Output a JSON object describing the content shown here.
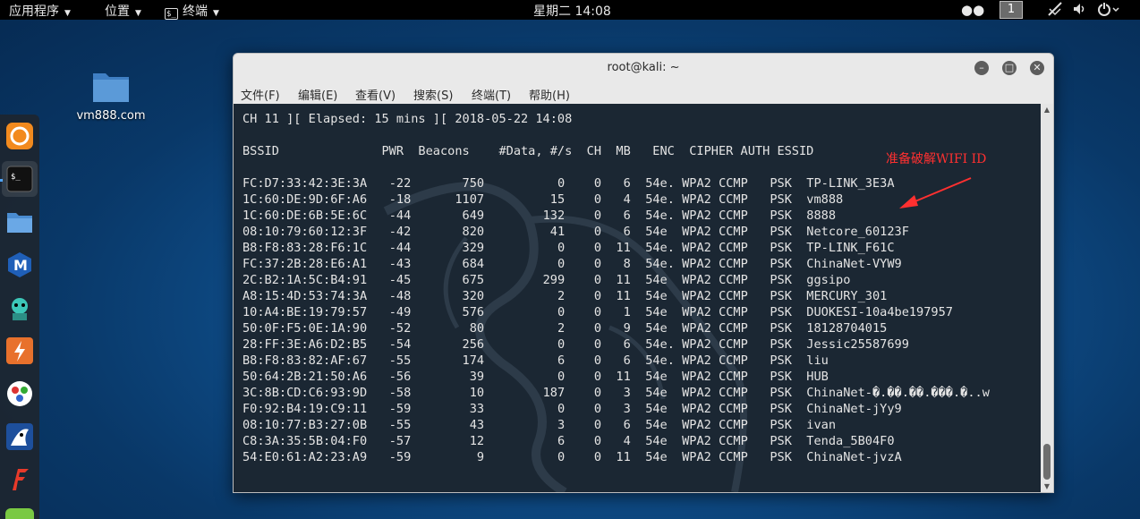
{
  "topbar": {
    "applications": "应用程序",
    "places": "位置",
    "terminal": "终端",
    "clock": "星期二 14:08",
    "workspace": "1"
  },
  "desktop": {
    "folder_label": "vm888.com"
  },
  "window": {
    "title": "root@kali: ~",
    "menu": [
      "文件(F)",
      "编辑(E)",
      "查看(V)",
      "搜索(S)",
      "终端(T)",
      "帮助(H)"
    ]
  },
  "terminal": {
    "status_line": "CH 11 ][ Elapsed: 15 mins ][ 2018-05-22 14:08",
    "header": "BSSID              PWR  Beacons    #Data, #/s  CH  MB   ENC  CIPHER AUTH ESSID",
    "rows": [
      {
        "bssid": "FC:D7:33:42:3E:3A",
        "pwr": "-22",
        "beacons": "750",
        "data": "0",
        "per_s": "0",
        "ch": "6",
        "mb": "54e.",
        "enc": "WPA2",
        "cipher": "CCMP",
        "auth": "PSK",
        "essid": "TP-LINK_3E3A"
      },
      {
        "bssid": "1C:60:DE:9D:6F:A6",
        "pwr": "-18",
        "beacons": "1107",
        "data": "15",
        "per_s": "0",
        "ch": "4",
        "mb": "54e.",
        "enc": "WPA2",
        "cipher": "CCMP",
        "auth": "PSK",
        "essid": "vm888"
      },
      {
        "bssid": "1C:60:DE:6B:5E:6C",
        "pwr": "-44",
        "beacons": "649",
        "data": "132",
        "per_s": "0",
        "ch": "6",
        "mb": "54e.",
        "enc": "WPA2",
        "cipher": "CCMP",
        "auth": "PSK",
        "essid": "8888"
      },
      {
        "bssid": "08:10:79:60:12:3F",
        "pwr": "-42",
        "beacons": "820",
        "data": "41",
        "per_s": "0",
        "ch": "6",
        "mb": "54e",
        "enc": "WPA2",
        "cipher": "CCMP",
        "auth": "PSK",
        "essid": "Netcore_60123F"
      },
      {
        "bssid": "B8:F8:83:28:F6:1C",
        "pwr": "-44",
        "beacons": "329",
        "data": "0",
        "per_s": "0",
        "ch": "11",
        "mb": "54e.",
        "enc": "WPA2",
        "cipher": "CCMP",
        "auth": "PSK",
        "essid": "TP-LINK_F61C"
      },
      {
        "bssid": "FC:37:2B:28:E6:A1",
        "pwr": "-43",
        "beacons": "684",
        "data": "0",
        "per_s": "0",
        "ch": "8",
        "mb": "54e.",
        "enc": "WPA2",
        "cipher": "CCMP",
        "auth": "PSK",
        "essid": "ChinaNet-VYW9"
      },
      {
        "bssid": "2C:B2:1A:5C:B4:91",
        "pwr": "-45",
        "beacons": "675",
        "data": "299",
        "per_s": "0",
        "ch": "11",
        "mb": "54e",
        "enc": "WPA2",
        "cipher": "CCMP",
        "auth": "PSK",
        "essid": "ggsipo"
      },
      {
        "bssid": "A8:15:4D:53:74:3A",
        "pwr": "-48",
        "beacons": "320",
        "data": "2",
        "per_s": "0",
        "ch": "11",
        "mb": "54e",
        "enc": "WPA2",
        "cipher": "CCMP",
        "auth": "PSK",
        "essid": "MERCURY_301"
      },
      {
        "bssid": "10:A4:BE:19:79:57",
        "pwr": "-49",
        "beacons": "576",
        "data": "0",
        "per_s": "0",
        "ch": "1",
        "mb": "54e",
        "enc": "WPA2",
        "cipher": "CCMP",
        "auth": "PSK",
        "essid": "DUOKESI-10a4be197957"
      },
      {
        "bssid": "50:0F:F5:0E:1A:90",
        "pwr": "-52",
        "beacons": "80",
        "data": "2",
        "per_s": "0",
        "ch": "9",
        "mb": "54e",
        "enc": "WPA2",
        "cipher": "CCMP",
        "auth": "PSK",
        "essid": "18128704015"
      },
      {
        "bssid": "28:FF:3E:A6:D2:B5",
        "pwr": "-54",
        "beacons": "256",
        "data": "0",
        "per_s": "0",
        "ch": "6",
        "mb": "54e.",
        "enc": "WPA2",
        "cipher": "CCMP",
        "auth": "PSK",
        "essid": "Jessic25587699"
      },
      {
        "bssid": "B8:F8:83:82:AF:67",
        "pwr": "-55",
        "beacons": "174",
        "data": "6",
        "per_s": "0",
        "ch": "6",
        "mb": "54e.",
        "enc": "WPA2",
        "cipher": "CCMP",
        "auth": "PSK",
        "essid": "liu"
      },
      {
        "bssid": "50:64:2B:21:50:A6",
        "pwr": "-56",
        "beacons": "39",
        "data": "0",
        "per_s": "0",
        "ch": "11",
        "mb": "54e",
        "enc": "WPA2",
        "cipher": "CCMP",
        "auth": "PSK",
        "essid": "HUB"
      },
      {
        "bssid": "3C:8B:CD:C6:93:9D",
        "pwr": "-58",
        "beacons": "10",
        "data": "187",
        "per_s": "0",
        "ch": "3",
        "mb": "54e",
        "enc": "WPA2",
        "cipher": "CCMP",
        "auth": "PSK",
        "essid": "ChinaNet-�.��.��.���.�..w"
      },
      {
        "bssid": "F0:92:B4:19:C9:11",
        "pwr": "-59",
        "beacons": "33",
        "data": "0",
        "per_s": "0",
        "ch": "3",
        "mb": "54e",
        "enc": "WPA2",
        "cipher": "CCMP",
        "auth": "PSK",
        "essid": "ChinaNet-jYy9"
      },
      {
        "bssid": "08:10:77:B3:27:0B",
        "pwr": "-55",
        "beacons": "43",
        "data": "3",
        "per_s": "0",
        "ch": "6",
        "mb": "54e",
        "enc": "WPA2",
        "cipher": "CCMP",
        "auth": "PSK",
        "essid": "ivan"
      },
      {
        "bssid": "C8:3A:35:5B:04:F0",
        "pwr": "-57",
        "beacons": "12",
        "data": "6",
        "per_s": "0",
        "ch": "4",
        "mb": "54e",
        "enc": "WPA2",
        "cipher": "CCMP",
        "auth": "PSK",
        "essid": "Tenda_5B04F0"
      },
      {
        "bssid": "54:E0:61:A2:23:A9",
        "pwr": "-59",
        "beacons": "9",
        "data": "0",
        "per_s": "0",
        "ch": "11",
        "mb": "54e",
        "enc": "WPA2",
        "cipher": "CCMP",
        "auth": "PSK",
        "essid": "ChinaNet-jvzA"
      }
    ]
  },
  "annotation": {
    "text": "准备破解WIFI ID",
    "color": "#ff3030"
  },
  "dock": {
    "items": [
      "firefox-icon",
      "terminal-icon",
      "files-icon",
      "maltego-icon",
      "armitage-icon",
      "burpsuite-icon",
      "faraday-icon",
      "beef-icon",
      "leafpad-icon",
      "show-apps-icon"
    ]
  },
  "colors": {
    "terminal_bg": "#1b2733",
    "accent": "#4aa3ff"
  }
}
